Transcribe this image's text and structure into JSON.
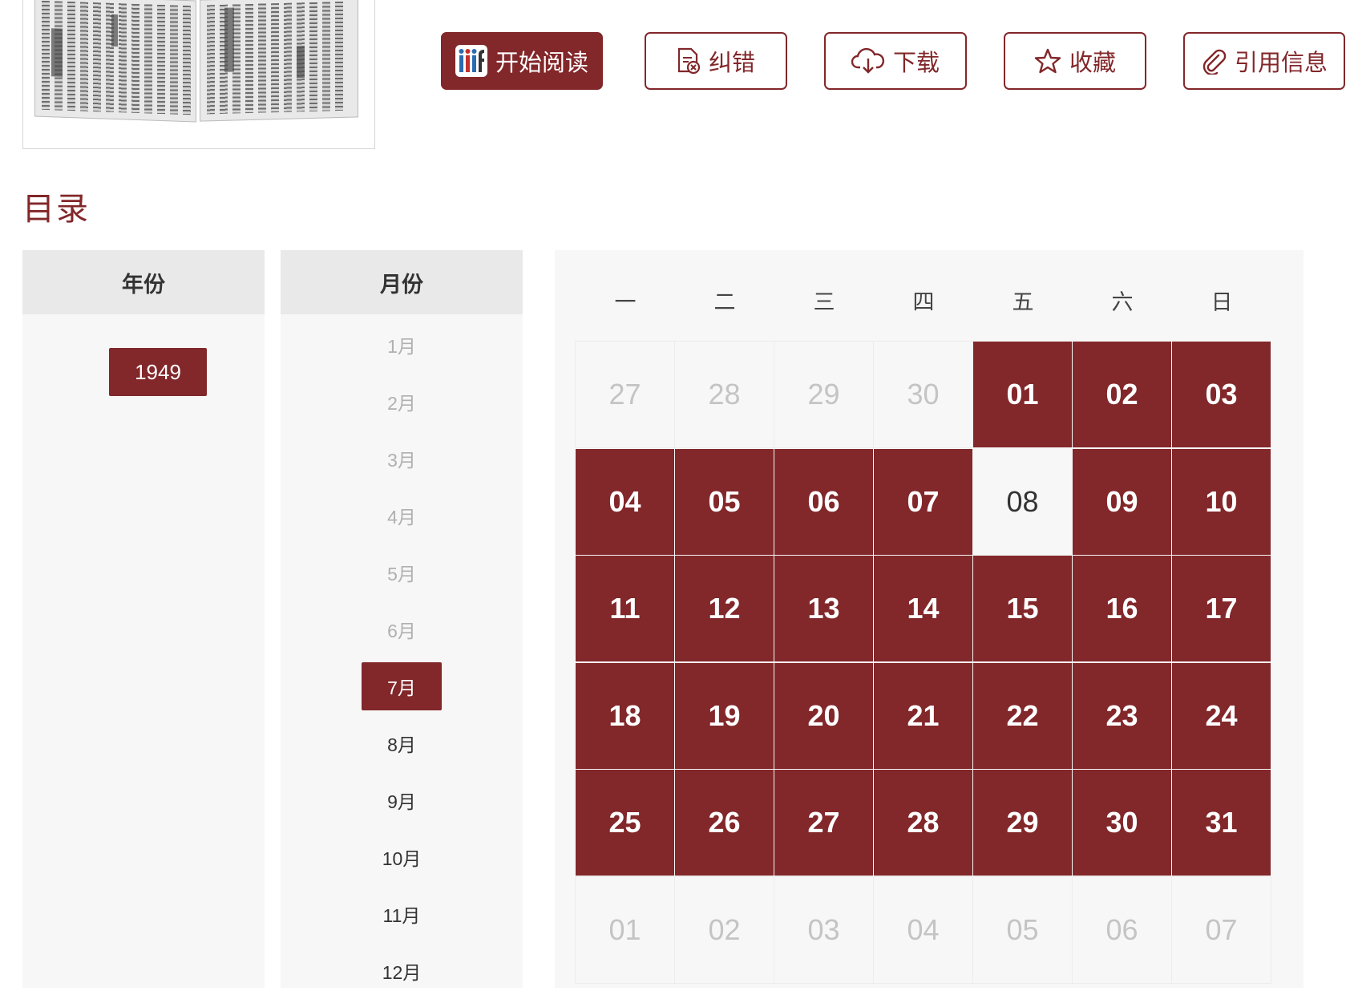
{
  "actions": [
    {
      "label": "开始阅读",
      "icon": "iiif-icon",
      "style": "primary"
    },
    {
      "label": "纠错",
      "icon": "correction-doc-icon",
      "style": "outline"
    },
    {
      "label": "下载",
      "icon": "cloud-download-icon",
      "style": "outline"
    },
    {
      "label": "收藏",
      "icon": "star-icon",
      "style": "outline"
    },
    {
      "label": "引用信息",
      "icon": "paperclip-icon",
      "style": "outline"
    }
  ],
  "catalog": {
    "title": "目录"
  },
  "years": {
    "header": "年份",
    "items": [
      "1949"
    ],
    "selected": "1949"
  },
  "months": {
    "header": "月份",
    "items": [
      {
        "label": "1月",
        "state": "disabled"
      },
      {
        "label": "2月",
        "state": "disabled"
      },
      {
        "label": "3月",
        "state": "disabled"
      },
      {
        "label": "4月",
        "state": "disabled"
      },
      {
        "label": "5月",
        "state": "disabled"
      },
      {
        "label": "6月",
        "state": "disabled"
      },
      {
        "label": "7月",
        "state": "active"
      },
      {
        "label": "8月",
        "state": "enabled"
      },
      {
        "label": "9月",
        "state": "enabled"
      },
      {
        "label": "10月",
        "state": "enabled"
      },
      {
        "label": "11月",
        "state": "enabled"
      },
      {
        "label": "12月",
        "state": "enabled"
      }
    ]
  },
  "calendar": {
    "weekdays": [
      "一",
      "二",
      "三",
      "四",
      "五",
      "六",
      "日"
    ],
    "days": [
      {
        "label": "27",
        "state": "outside"
      },
      {
        "label": "28",
        "state": "outside"
      },
      {
        "label": "29",
        "state": "outside"
      },
      {
        "label": "30",
        "state": "outside"
      },
      {
        "label": "01",
        "state": "available"
      },
      {
        "label": "02",
        "state": "available"
      },
      {
        "label": "03",
        "state": "available"
      },
      {
        "label": "04",
        "state": "available"
      },
      {
        "label": "05",
        "state": "available"
      },
      {
        "label": "06",
        "state": "available"
      },
      {
        "label": "07",
        "state": "available"
      },
      {
        "label": "08",
        "state": "empty"
      },
      {
        "label": "09",
        "state": "available"
      },
      {
        "label": "10",
        "state": "available"
      },
      {
        "label": "11",
        "state": "available"
      },
      {
        "label": "12",
        "state": "available"
      },
      {
        "label": "13",
        "state": "available"
      },
      {
        "label": "14",
        "state": "available"
      },
      {
        "label": "15",
        "state": "available"
      },
      {
        "label": "16",
        "state": "available"
      },
      {
        "label": "17",
        "state": "available"
      },
      {
        "label": "18",
        "state": "available"
      },
      {
        "label": "19",
        "state": "available"
      },
      {
        "label": "20",
        "state": "available"
      },
      {
        "label": "21",
        "state": "available"
      },
      {
        "label": "22",
        "state": "available"
      },
      {
        "label": "23",
        "state": "available"
      },
      {
        "label": "24",
        "state": "available"
      },
      {
        "label": "25",
        "state": "available"
      },
      {
        "label": "26",
        "state": "available"
      },
      {
        "label": "27",
        "state": "available"
      },
      {
        "label": "28",
        "state": "available"
      },
      {
        "label": "29",
        "state": "available"
      },
      {
        "label": "30",
        "state": "available"
      },
      {
        "label": "31",
        "state": "available"
      },
      {
        "label": "01",
        "state": "outside"
      },
      {
        "label": "02",
        "state": "outside"
      },
      {
        "label": "03",
        "state": "outside"
      },
      {
        "label": "04",
        "state": "outside"
      },
      {
        "label": "05",
        "state": "outside"
      },
      {
        "label": "06",
        "state": "outside"
      },
      {
        "label": "07",
        "state": "outside"
      }
    ]
  },
  "colors": {
    "accent": "#82272a",
    "panel_bg": "#f7f7f7",
    "header_bg": "#e9e9e9",
    "muted_text": "#b0b0b0"
  }
}
